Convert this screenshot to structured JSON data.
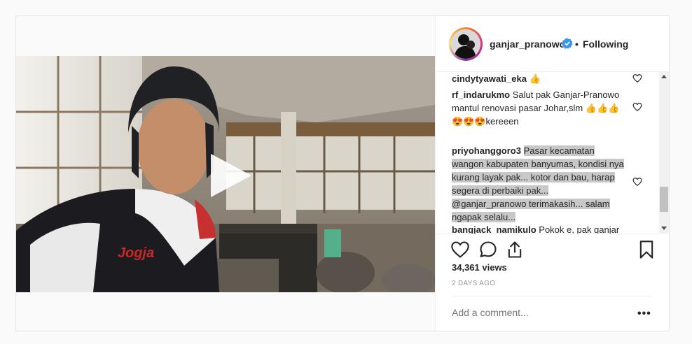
{
  "post": {
    "author": "ganjar_pranowo",
    "follow_status": "Following",
    "separator": "•",
    "views": "34,361 views",
    "timestamp": "2 DAYS AGO",
    "comment_placeholder": "Add a comment...",
    "more_label": "•••"
  },
  "comments": [
    {
      "user": "cindytyawati_eka",
      "text": "👍"
    },
    {
      "user": "rf_indarukmo",
      "text": "Salut pak Ganjar-Pranowo mantul renovasi pasar Johar,slm 👍👍👍😍😍😍kereeen"
    },
    {
      "user": "priyohanggoro3",
      "text": "Pasar kecamatan wangon kabupaten banyumas, kondisi nya kurang layak pak... kotor dan bau, harap segera di perbaiki pak... @ganjar_pranowo terimakasih... salam ngapak selalu..."
    },
    {
      "user": "bangjack_namikulo",
      "text": "Pokok e, pak ganjar nyalon lagi awasss tak coblos"
    }
  ],
  "icons": {
    "play": "play-icon",
    "verified": "verified-badge-icon",
    "like": "heart-icon",
    "comment": "comment-icon",
    "share": "share-icon",
    "save": "bookmark-icon"
  },
  "colors": {
    "verified": "#3897f0",
    "selection_highlight": "#c8c8c8",
    "muted_text": "#999999"
  }
}
